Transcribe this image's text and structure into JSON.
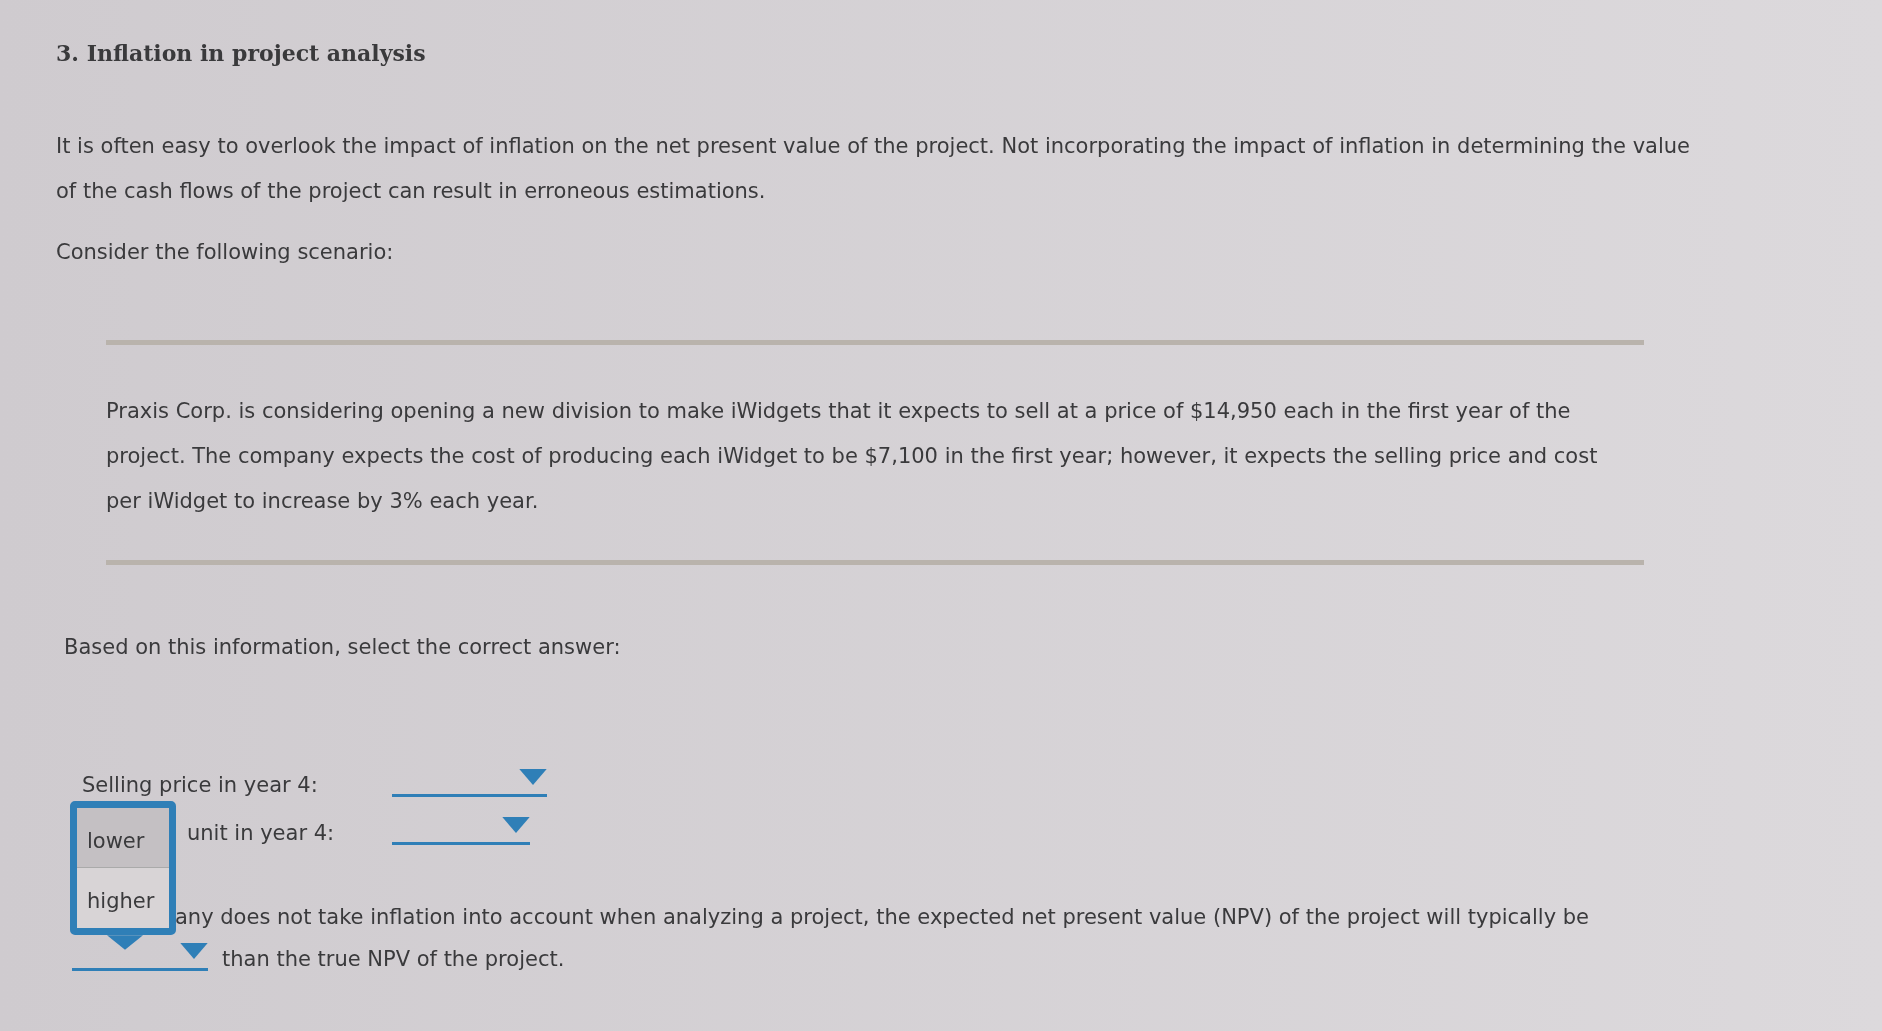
{
  "title": "3. Inflation in project analysis",
  "intro": "It is often easy to overlook the impact of inflation on the net present value of the project. Not incorporating the impact of inflation in determining the value of the cash flows of the project can result in erroneous estimations.",
  "prompt": "Consider the following scenario:",
  "scenario": "Praxis Corp. is considering opening a new division to make iWidgets that it expects to sell at a price of $14,950 each in the first year of the project. The company expects the cost of producing each iWidget to be $7,100 in the first year; however, it expects the selling price and cost per iWidget to increase by 3% each year.",
  "instruction": "Based on this information, select the correct answer:",
  "rows": [
    {
      "label": "Selling price in year 4:"
    },
    {
      "label": "unit in year 4:"
    }
  ],
  "statement": {
    "before": "any does not take inflation into account when analyzing a project, the expected net present value (NPV) of the project will typically be",
    "after": "than the true NPV of the project."
  },
  "dropdown_menu": {
    "options": [
      {
        "label": "lower",
        "selected": true
      },
      {
        "label": "higher",
        "selected": false
      }
    ]
  }
}
